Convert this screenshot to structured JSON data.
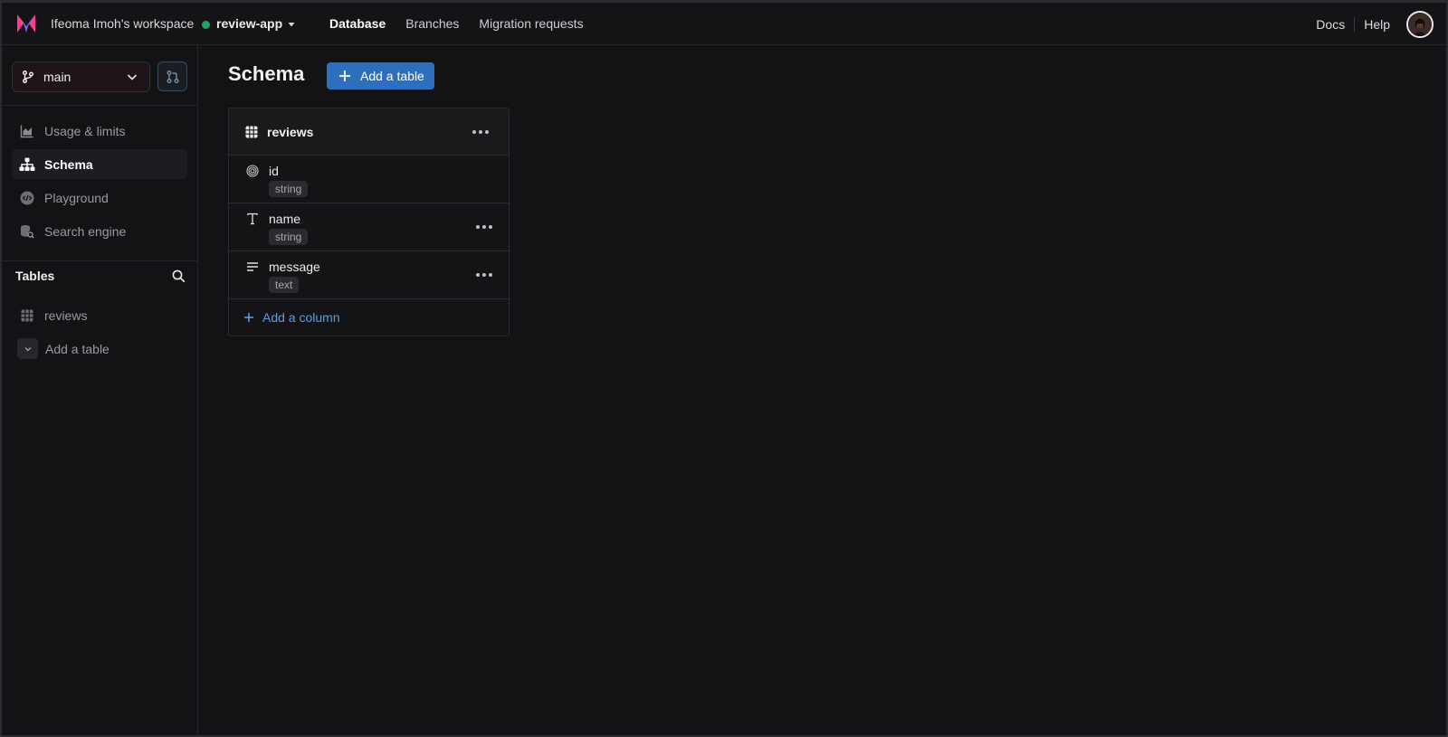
{
  "header": {
    "workspace": "Ifeoma Imoh's workspace",
    "database": "review-app",
    "db_status_color": "#22a06b",
    "nav": [
      {
        "label": "Database",
        "active": true
      },
      {
        "label": "Branches",
        "active": false
      },
      {
        "label": "Migration requests",
        "active": false
      }
    ],
    "docs": "Docs",
    "help": "Help"
  },
  "sidebar": {
    "branch": "main",
    "menu": [
      {
        "label": "Usage & limits",
        "icon": "chart-icon",
        "active": false
      },
      {
        "label": "Schema",
        "icon": "schema-icon",
        "active": true
      },
      {
        "label": "Playground",
        "icon": "playground-icon",
        "active": false
      },
      {
        "label": "Search engine",
        "icon": "search-engine-icon",
        "active": false
      }
    ],
    "tables_title": "Tables",
    "tables": [
      {
        "label": "reviews",
        "icon": "table-grid-icon"
      }
    ],
    "add_table": "Add a table"
  },
  "main": {
    "title": "Schema",
    "add_table_button": "Add a table",
    "table": {
      "name": "reviews",
      "columns": [
        {
          "name": "id",
          "type": "string",
          "icon": "fingerprint-icon",
          "has_menu": false
        },
        {
          "name": "name",
          "type": "string",
          "icon": "text-icon",
          "has_menu": true
        },
        {
          "name": "message",
          "type": "text",
          "icon": "paragraph-icon",
          "has_menu": true
        }
      ],
      "add_column": "Add a column"
    }
  },
  "colors": {
    "accent": "#2e6fbd",
    "link": "#5a9ee6",
    "background": "#131315"
  }
}
